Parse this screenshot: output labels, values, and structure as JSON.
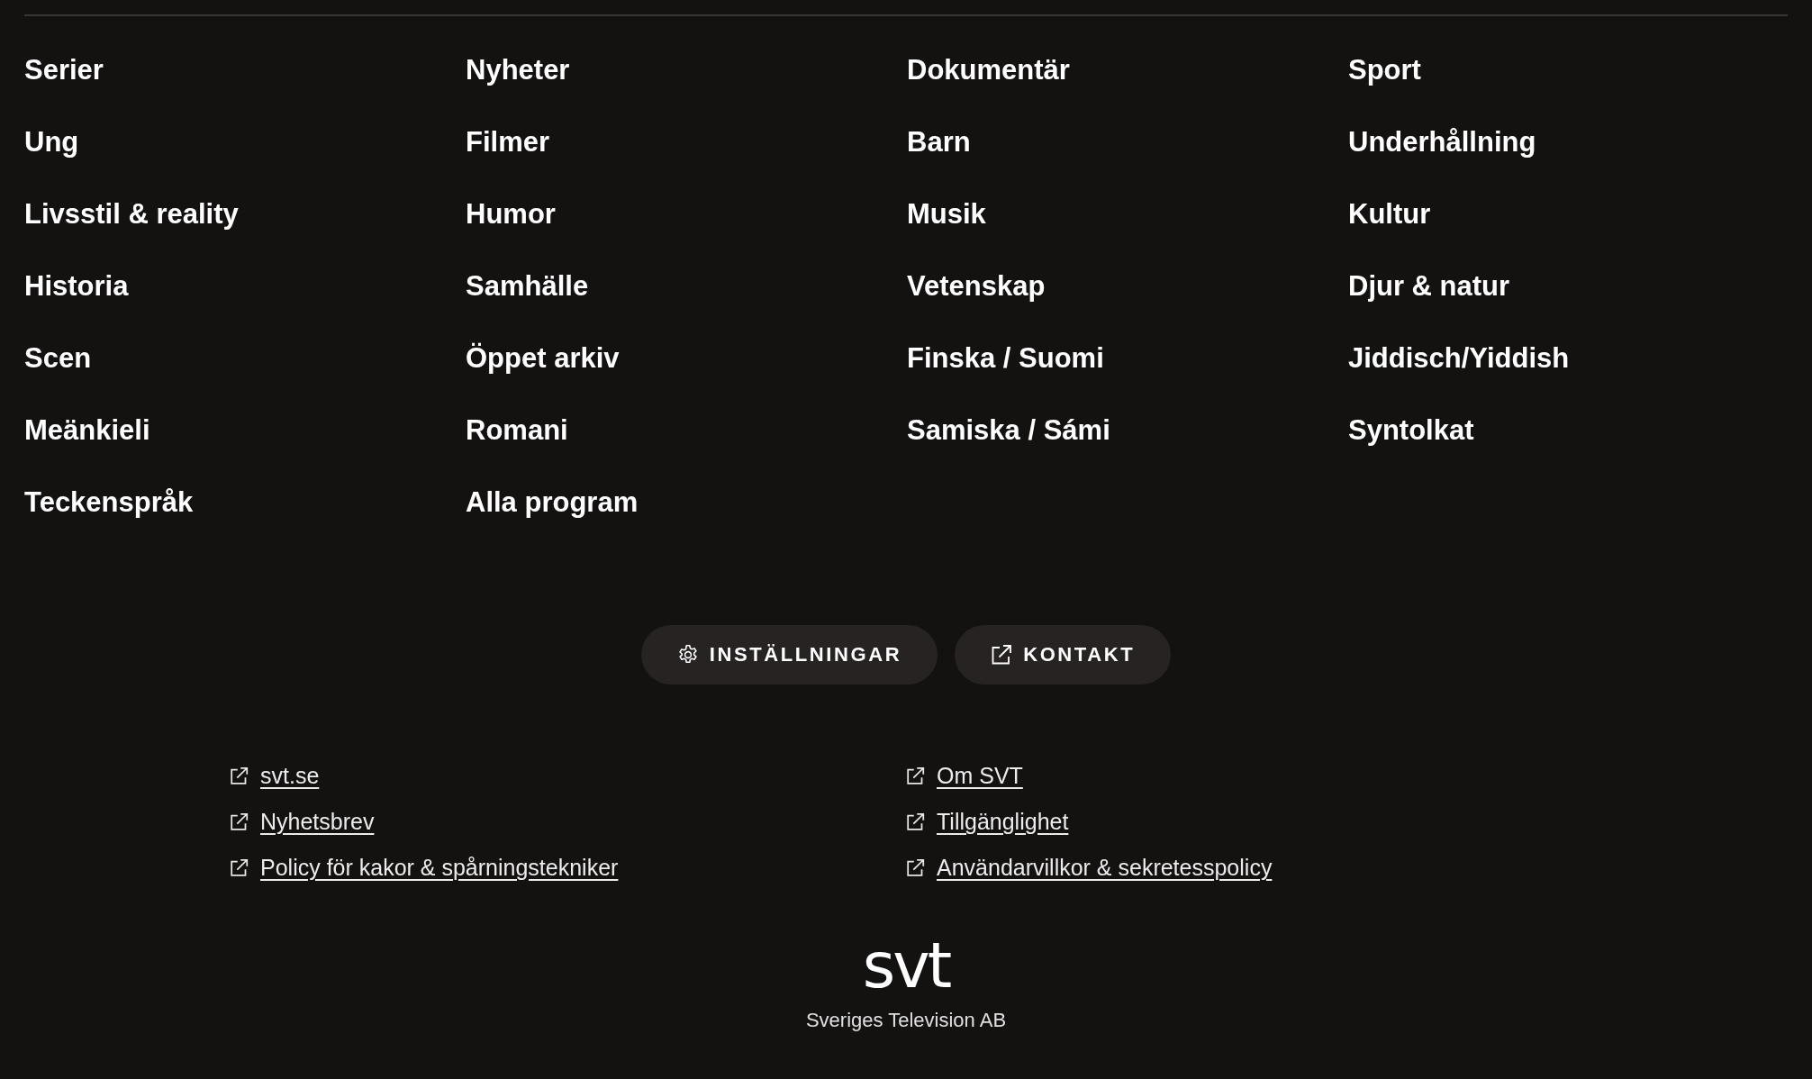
{
  "categories": [
    "Serier",
    "Nyheter",
    "Dokumentär",
    "Sport",
    "Ung",
    "Filmer",
    "Barn",
    "Underhållning",
    "Livsstil & reality",
    "Humor",
    "Musik",
    "Kultur",
    "Historia",
    "Samhälle",
    "Vetenskap",
    "Djur & natur",
    "Scen",
    "Öppet arkiv",
    "Finska / Suomi",
    "Jiddisch/Yiddish",
    "Meänkieli",
    "Romani",
    "Samiska / Sámi",
    "Syntolkat",
    "Teckenspråk",
    "Alla program"
  ],
  "buttons": [
    {
      "label": "INSTÄLLNINGAR",
      "kind": "settings"
    },
    {
      "label": "KONTAKT",
      "kind": "external"
    }
  ],
  "link_columns": [
    [
      "svt.se",
      "Nyhetsbrev",
      "Policy för kakor & spårningstekniker"
    ],
    [
      "Om SVT",
      "Tillgänglighet",
      "Användarvillkor & sekretesspolicy"
    ]
  ],
  "logo": "svt",
  "company": "Sveriges Television AB"
}
